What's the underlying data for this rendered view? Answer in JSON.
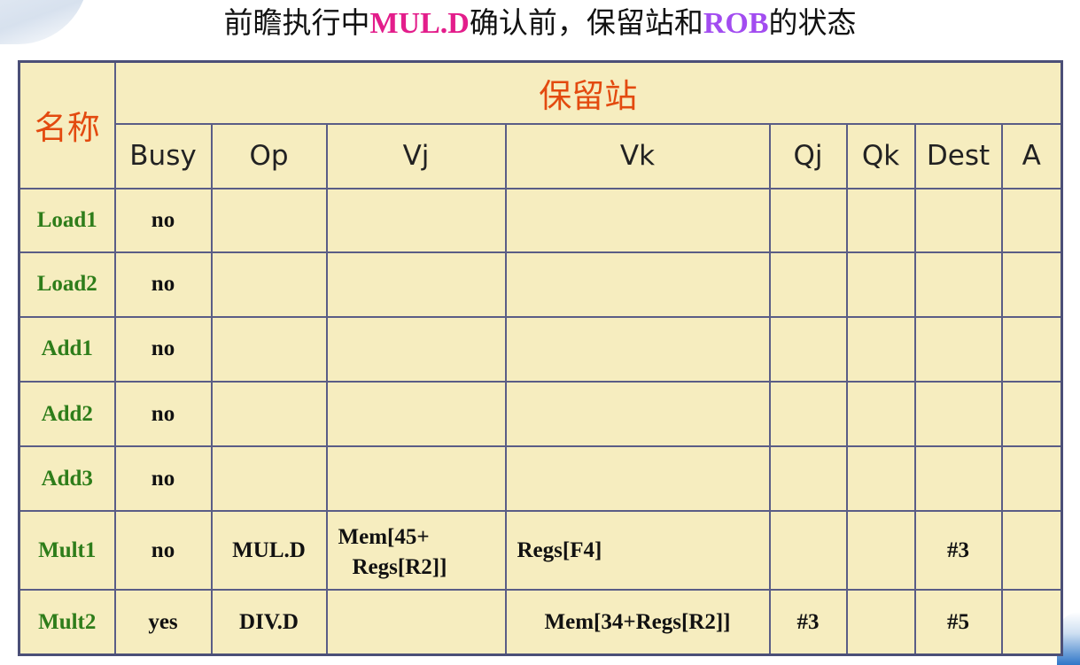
{
  "title": {
    "part1": "前瞻执行中",
    "mul": "MUL.D",
    "part2": "确认前，保留站和",
    "rob": "ROB",
    "part3": "的状态"
  },
  "table": {
    "name_header": "名称",
    "group_header": "保留站",
    "columns": [
      "Busy",
      "Op",
      "Vj",
      "Vk",
      "Qj",
      "Qk",
      "Dest",
      "A"
    ],
    "rows": [
      {
        "name": "Load1",
        "busy": "no",
        "op": "",
        "vj_line1": "",
        "vj_line2": "",
        "vk": "",
        "qj": "",
        "qk": "",
        "dest": "",
        "a": ""
      },
      {
        "name": "Load2",
        "busy": "no",
        "op": "",
        "vj_line1": "",
        "vj_line2": "",
        "vk": "",
        "qj": "",
        "qk": "",
        "dest": "",
        "a": ""
      },
      {
        "name": "Add1",
        "busy": "no",
        "op": "",
        "vj_line1": "",
        "vj_line2": "",
        "vk": "",
        "qj": "",
        "qk": "",
        "dest": "",
        "a": ""
      },
      {
        "name": "Add2",
        "busy": "no",
        "op": "",
        "vj_line1": "",
        "vj_line2": "",
        "vk": "",
        "qj": "",
        "qk": "",
        "dest": "",
        "a": ""
      },
      {
        "name": "Add3",
        "busy": "no",
        "op": "",
        "vj_line1": "",
        "vj_line2": "",
        "vk": "",
        "qj": "",
        "qk": "",
        "dest": "",
        "a": ""
      },
      {
        "name": "Mult1",
        "busy": "no",
        "op": "MUL.D",
        "vj_line1": "Mem[45+",
        "vj_line2": "Regs[R2]]",
        "vk": "Regs[F4]",
        "qj": "",
        "qk": "",
        "dest": "#3",
        "a": ""
      },
      {
        "name": "Mult2",
        "busy": "yes",
        "op": "DIV.D",
        "vj_line1": "",
        "vj_line2": "",
        "vk": "Mem[34+Regs[R2]]",
        "qj": "#3",
        "qk": "",
        "dest": "#5",
        "a": ""
      }
    ]
  }
}
